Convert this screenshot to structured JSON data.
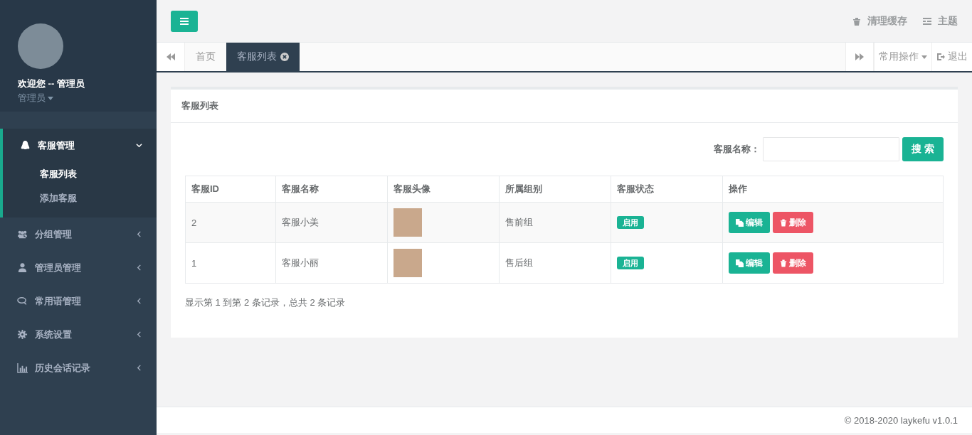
{
  "sidebar": {
    "welcome": "欢迎您 -- 管理员",
    "role": "管理员",
    "items": [
      {
        "label": "客服管理",
        "expanded": true,
        "selected": true,
        "children": [
          {
            "label": "客服列表",
            "selected": true
          },
          {
            "label": "添加客服",
            "selected": false
          }
        ]
      },
      {
        "label": "分组管理",
        "expanded": false,
        "selected": false
      },
      {
        "label": "管理员管理",
        "expanded": false,
        "selected": false
      },
      {
        "label": "常用语管理",
        "expanded": false,
        "selected": false
      },
      {
        "label": "系统设置",
        "expanded": false,
        "selected": false
      },
      {
        "label": "历史会话记录",
        "expanded": false,
        "selected": false
      }
    ]
  },
  "header": {
    "links": [
      "清理缓存",
      "主题"
    ]
  },
  "tabs": [
    {
      "label": "首页",
      "selected": false,
      "closable": false
    },
    {
      "label": "客服列表",
      "selected": true,
      "closable": true
    }
  ],
  "tab_actions": {
    "menu": "常用操作",
    "logout": "退出"
  },
  "panel": {
    "title": "客服列表",
    "search_label": "客服名称：",
    "search_button": "搜 索",
    "table": {
      "columns": [
        "客服ID",
        "客服名称",
        "客服头像",
        "所属组别",
        "客服状态",
        "操作"
      ],
      "rows": [
        {
          "id": "2",
          "name": "客服小美",
          "group": "售前组",
          "status": "启用",
          "edit": "编辑",
          "delete": "删除"
        },
        {
          "id": "1",
          "name": "客服小丽",
          "group": "售后组",
          "status": "启用",
          "edit": "编辑",
          "delete": "删除"
        }
      ]
    },
    "summary": "显示第 1 到第 2 条记录，总共 2 条记录"
  },
  "footer": "© 2018-2020 laykefu v1.0.1"
}
